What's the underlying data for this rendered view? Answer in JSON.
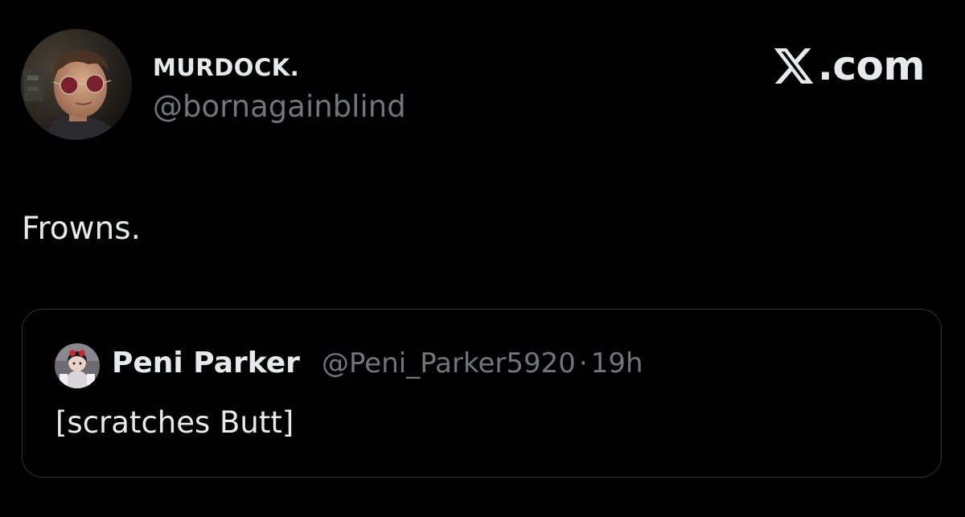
{
  "tweet": {
    "author": {
      "display_name": "MURDOCK.",
      "handle": "@bornagainblind",
      "avatar_icon": "profile-photo-person-red-glasses"
    },
    "text": "Frowns.",
    "brand": {
      "logo_icon": "x-logo-icon",
      "suffix": ".com"
    }
  },
  "quoted_tweet": {
    "author": {
      "display_name": "Peni Parker",
      "handle": "@Peni_Parker5920",
      "avatar_icon": "profile-photo-anime-character"
    },
    "separator": "·",
    "time": "19h",
    "text": "[scratches Butt]"
  },
  "colors": {
    "background": "#000000",
    "primary_text": "#e7e9ea",
    "secondary_text": "#71767b",
    "border": "#2f3336"
  }
}
